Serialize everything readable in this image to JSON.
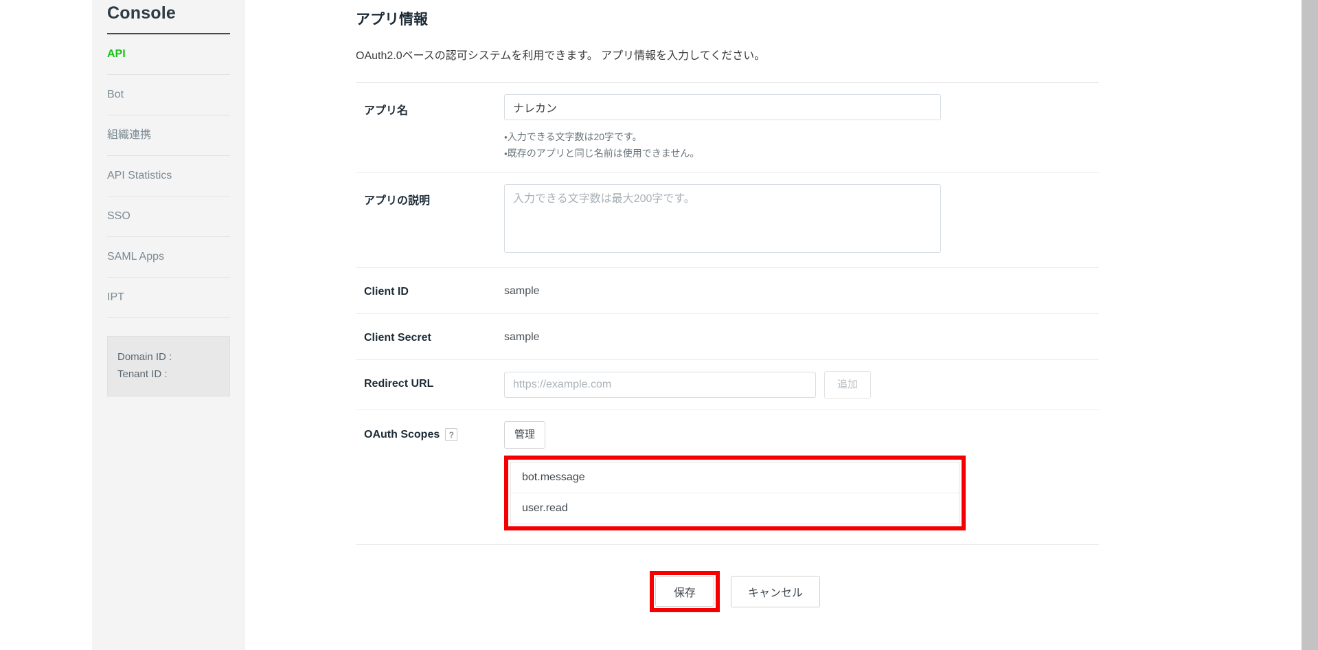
{
  "sidebar": {
    "title": "Console",
    "items": [
      {
        "label": "API",
        "active": true
      },
      {
        "label": "Bot",
        "active": false
      },
      {
        "label": "組織連携",
        "active": false
      },
      {
        "label": "API Statistics",
        "active": false
      },
      {
        "label": "SSO",
        "active": false
      },
      {
        "label": "SAML Apps",
        "active": false
      },
      {
        "label": "IPT",
        "active": false
      }
    ],
    "info_box": {
      "domain_id_label": "Domain ID :",
      "tenant_id_label": "Tenant ID :"
    }
  },
  "main": {
    "title": "アプリ情報",
    "description": "OAuth2.0ベースの認可システムを利用できます。 アプリ情報を入力してください。",
    "fields": {
      "app_name": {
        "label": "アプリ名",
        "value": "ナレカン",
        "hints": [
          "・入力できる文字数は20字です。",
          "・既存のアプリと同じ名前は使用できません。"
        ]
      },
      "app_description": {
        "label": "アプリの説明",
        "value": "",
        "placeholder": "入力できる文字数は最大200字です。"
      },
      "client_id": {
        "label": "Client ID",
        "value": "sample"
      },
      "client_secret": {
        "label": "Client Secret",
        "value": "sample"
      },
      "redirect_url": {
        "label": "Redirect URL",
        "value": "",
        "placeholder": "https://example.com",
        "add_button_label": "追加"
      },
      "oauth_scopes": {
        "label": "OAuth Scopes",
        "help_icon_label": "?",
        "manage_button_label": "管理",
        "items": [
          "bot.message",
          "user.read"
        ]
      }
    },
    "actions": {
      "save_label": "保存",
      "cancel_label": "キャンセル"
    }
  },
  "annotations": {
    "highlight_color": "#f50000"
  }
}
